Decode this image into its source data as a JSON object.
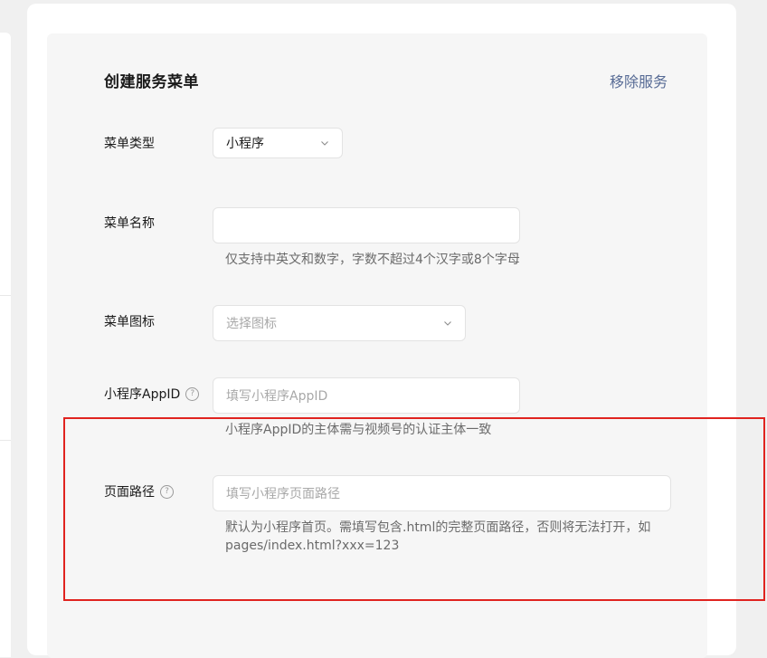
{
  "form": {
    "title": "创建服务菜单",
    "remove_label": "移除服务",
    "menu_type": {
      "label": "菜单类型",
      "value": "小程序"
    },
    "menu_name": {
      "label": "菜单名称",
      "value": "",
      "hint": "仅支持中英文和数字，字数不超过4个汉字或8个字母"
    },
    "menu_icon": {
      "label": "菜单图标",
      "placeholder": "选择图标"
    },
    "appid": {
      "label": "小程序AppID",
      "placeholder": "填写小程序AppID",
      "hint": "小程序AppID的主体需与视频号的认证主体一致"
    },
    "page_path": {
      "label": "页面路径",
      "placeholder": "填写小程序页面路径",
      "hint_line1": "默认为小程序首页。需填写包含.html的完整页面路径，否则将无法打开，如",
      "hint_line2": "pages/index.html?xxx=123"
    }
  },
  "colors": {
    "link": "#576b95",
    "highlight": "#e0231f",
    "panel": "#f6f6f6"
  }
}
